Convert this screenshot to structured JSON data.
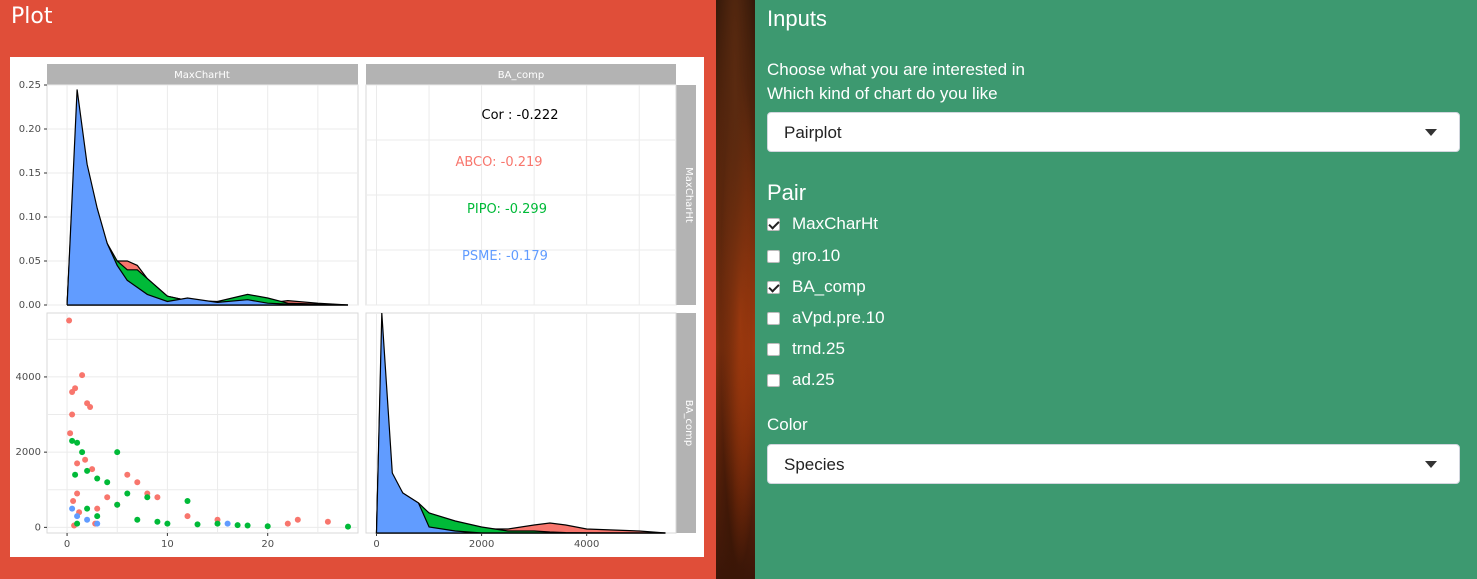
{
  "plot_panel": {
    "title": "Plot"
  },
  "inputs_panel": {
    "title": "Inputs",
    "prompt_interest": "Choose what you are interested in",
    "prompt_chart": "Which kind of chart do you like",
    "chart_select": {
      "value": "Pairplot"
    },
    "pair_title": "Pair",
    "pair_options": [
      {
        "label": "MaxCharHt",
        "checked": true
      },
      {
        "label": "gro.10",
        "checked": false
      },
      {
        "label": "BA_comp",
        "checked": true
      },
      {
        "label": "aVpd.pre.10",
        "checked": false
      },
      {
        "label": "trnd.25",
        "checked": false
      },
      {
        "label": "ad.25",
        "checked": false
      }
    ],
    "color_label": "Color",
    "color_select": {
      "value": "Species"
    }
  },
  "colors": {
    "ABCO": "#f8766d",
    "PIPO": "#00ba38",
    "PSME": "#619cff",
    "plot_panel_bg": "#e04e39",
    "inputs_panel_bg": "#3d9970"
  },
  "chart_data": {
    "type": "pairplot",
    "variables": [
      "MaxCharHt",
      "BA_comp"
    ],
    "strip_labels": {
      "top": [
        "MaxCharHt",
        "BA_comp"
      ],
      "right": [
        "MaxCharHt",
        "BA_comp"
      ]
    },
    "density_maxcharht": {
      "type": "area",
      "xlim": [
        -2,
        29
      ],
      "ylim": [
        0,
        0.25
      ],
      "y_ticks": [
        "0.00",
        "0.05",
        "0.10",
        "0.15",
        "0.20",
        "0.25"
      ],
      "series": [
        {
          "name": "ABCO",
          "x": [
            0,
            1,
            2,
            3,
            4,
            5,
            6,
            7,
            8,
            10,
            12,
            15,
            18,
            20,
            22,
            25,
            28
          ],
          "values": [
            0,
            0.22,
            0.14,
            0.09,
            0.06,
            0.05,
            0.05,
            0.045,
            0.03,
            0.01,
            0.005,
            0.003,
            0.004,
            0.002,
            0.005,
            0.002,
            0
          ]
        },
        {
          "name": "PIPO",
          "x": [
            0,
            1,
            2,
            3,
            4,
            5,
            6,
            7,
            8,
            10,
            12,
            15,
            18,
            20,
            22,
            25,
            28
          ],
          "values": [
            0,
            0.23,
            0.15,
            0.1,
            0.07,
            0.05,
            0.04,
            0.04,
            0.03,
            0.01,
            0.005,
            0.004,
            0.012,
            0.008,
            0.002,
            0.001,
            0
          ]
        },
        {
          "name": "PSME",
          "x": [
            0,
            1,
            2,
            3,
            4,
            5,
            6,
            7,
            8,
            10,
            12,
            15,
            18,
            20,
            22,
            25,
            28
          ],
          "values": [
            0,
            0.245,
            0.16,
            0.11,
            0.07,
            0.045,
            0.028,
            0.02,
            0.012,
            0.004,
            0.008,
            0.003,
            0.006,
            0.002,
            0.001,
            0,
            0
          ]
        }
      ]
    },
    "correlation": {
      "overall_label": "Cor : -0.222",
      "groups": [
        {
          "name": "ABCO",
          "label": "ABCO: -0.219"
        },
        {
          "name": "PIPO",
          "label": "PIPO: -0.299"
        },
        {
          "name": "PSME",
          "label": "PSME: -0.179"
        }
      ]
    },
    "scatter": {
      "type": "scatter",
      "xlim": [
        -2,
        29
      ],
      "ylim": [
        -150,
        5700
      ],
      "x_ticks": [
        "0",
        "10",
        "20"
      ],
      "y_ticks": [
        "0",
        "2000",
        "4000"
      ],
      "series": [
        {
          "name": "ABCO",
          "x": [
            0.2,
            0.5,
            1.5,
            0.8,
            2,
            2.3,
            0.5,
            1,
            1.8,
            2.5,
            6,
            7,
            8,
            4,
            5,
            3,
            12,
            15,
            22,
            23,
            26,
            1,
            0.6,
            0.3,
            2.8,
            9,
            0.7,
            1.2
          ],
          "y": [
            5500,
            3600,
            4050,
            3700,
            3300,
            3200,
            3000,
            1700,
            1800,
            1550,
            1400,
            1200,
            900,
            800,
            600,
            500,
            300,
            200,
            100,
            200,
            150,
            900,
            700,
            2500,
            100,
            800,
            50,
            400
          ]
        },
        {
          "name": "PIPO",
          "x": [
            0.5,
            1,
            1.5,
            2,
            3,
            4,
            5,
            6,
            8,
            10,
            12,
            15,
            18,
            20,
            28,
            2,
            3,
            1,
            0.8,
            5,
            7,
            9,
            13,
            17
          ],
          "y": [
            2300,
            2250,
            2000,
            1500,
            1300,
            1200,
            2000,
            900,
            800,
            100,
            700,
            100,
            50,
            30,
            20,
            500,
            300,
            100,
            1400,
            600,
            200,
            150,
            80,
            60
          ]
        },
        {
          "name": "PSME",
          "x": [
            1,
            2,
            3,
            16,
            0.5
          ],
          "y": [
            300,
            200,
            100,
            100,
            500
          ]
        }
      ]
    },
    "density_ba_comp": {
      "type": "area",
      "xlim": [
        -200,
        5700
      ],
      "x_ticks": [
        "0",
        "2000",
        "4000"
      ],
      "ylim": [
        0,
        0.0011
      ],
      "series": [
        {
          "name": "ABCO",
          "x": [
            0,
            100,
            300,
            500,
            800,
            1000,
            1500,
            2000,
            2500,
            3000,
            3300,
            3600,
            4000,
            5000,
            5500
          ],
          "values": [
            0,
            0.00103,
            0.00025,
            0.00018,
            0.00014,
            0.0001,
            5e-05,
            2e-05,
            2e-05,
            4e-05,
            5e-05,
            4e-05,
            2e-05,
            1e-05,
            0
          ]
        },
        {
          "name": "PIPO",
          "x": [
            0,
            100,
            300,
            500,
            800,
            1000,
            1500,
            2000,
            2500,
            3000,
            3300,
            3600,
            4000,
            5000,
            5500
          ],
          "values": [
            0,
            0.001,
            0.00028,
            0.0002,
            0.00015,
            0.0001,
            6e-05,
            3e-05,
            1e-05,
            1e-05,
            5e-06,
            2e-06,
            1e-06,
            0,
            0
          ]
        },
        {
          "name": "PSME",
          "x": [
            0,
            100,
            300,
            500,
            800,
            1000,
            1500,
            2000,
            2500,
            3000,
            3300,
            3600,
            4000,
            5000,
            5500
          ],
          "values": [
            0,
            0.0011,
            0.0003,
            0.0002,
            0.00015,
            3e-05,
            1e-05,
            0,
            0,
            0,
            0,
            0,
            0,
            0,
            0
          ]
        }
      ]
    }
  }
}
